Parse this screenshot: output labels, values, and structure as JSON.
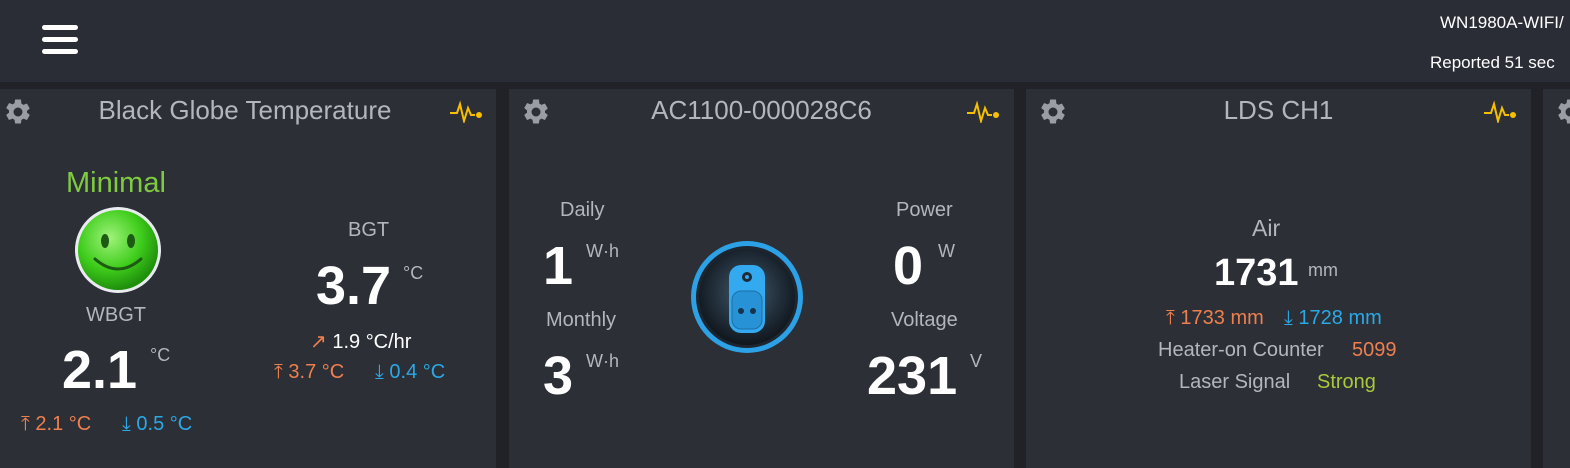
{
  "header": {
    "device_name": "WN1980A-WIFI/",
    "reported": "Reported 51 sec"
  },
  "card1": {
    "title": "Black Globe Temperature",
    "status": "Minimal",
    "status_color": "#7ecb3f",
    "wbgt": {
      "label": "WBGT",
      "value": "2.1",
      "unit": "°C",
      "high": "2.1 °C",
      "low": "0.5 °C"
    },
    "bgt": {
      "label": "BGT",
      "value": "3.7",
      "unit": "°C",
      "trend": "1.9 °C/hr",
      "high": "3.7 °C",
      "low": "0.4 °C"
    }
  },
  "card2": {
    "title": "AC1100-000028C6",
    "daily": {
      "label": "Daily",
      "value": "1",
      "unit": "W·h"
    },
    "monthly": {
      "label": "Monthly",
      "value": "3",
      "unit": "W·h"
    },
    "power": {
      "label": "Power",
      "value": "0",
      "unit": "W"
    },
    "voltage": {
      "label": "Voltage",
      "value": "231",
      "unit": "V"
    }
  },
  "card3": {
    "title": "LDS CH1",
    "medium": "Air",
    "value": "1731",
    "unit": "mm",
    "high": "1733 mm",
    "low": "1728 mm",
    "heater_label": "Heater-on Counter",
    "heater_value": "5099",
    "laser_label": "Laser Signal",
    "laser_value": "Strong",
    "laser_color": "#a9c93c"
  },
  "colors": {
    "accent": "#f6c000",
    "high": "#ee7f4e",
    "low": "#2aa9e6",
    "card": "#2c2f36"
  }
}
